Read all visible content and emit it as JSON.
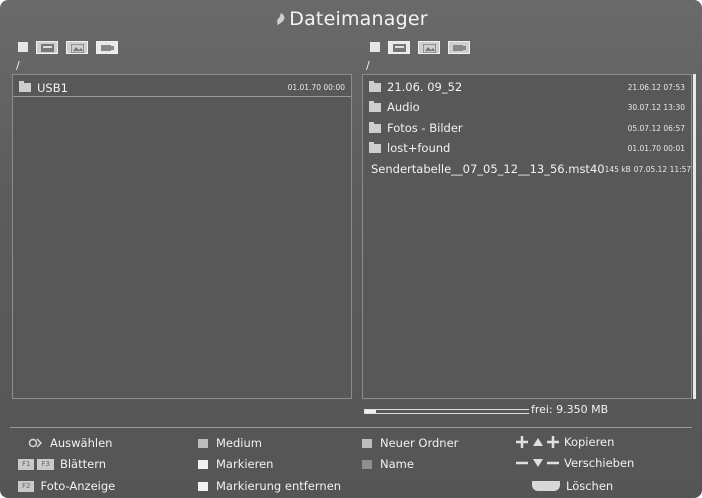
{
  "title": "Dateimanager",
  "left_pane": {
    "path": "/",
    "items": [
      {
        "name": "USB1",
        "date": "01.01.70 00:00",
        "icon": "folder-icon"
      }
    ]
  },
  "right_pane": {
    "path": "/",
    "items": [
      {
        "name": "21.06. 09_52",
        "date": "21.06.12 07:53",
        "icon": "folder-icon"
      },
      {
        "name": "Audio",
        "date": "30.07.12 13:30",
        "icon": "folder-icon"
      },
      {
        "name": "Fotos - Bilder",
        "date": "05.07.12 06:57",
        "icon": "folder-icon"
      },
      {
        "name": "lost+found",
        "date": "01.01.70 00:01",
        "icon": "folder-icon"
      },
      {
        "name": "Sendertabelle__07_05_12__13_56.mst40",
        "size": "145 kB",
        "date": "07.05.12 11:57",
        "icon": "file-icon"
      }
    ],
    "free_space": "frei: 9.350 MB",
    "used_fraction": 0.07
  },
  "legend": {
    "ok": "Auswählen",
    "f1": "F1",
    "f3": "F3",
    "blaettern": "Blättern",
    "f2": "F2",
    "foto": "Foto-Anzeige",
    "medium": "Medium",
    "markieren": "Markieren",
    "markierung_entfernen": "Markierung entfernen",
    "neuer_ordner": "Neuer Ordner",
    "name": "Name",
    "kopieren": "Kopieren",
    "verschieben": "Verschieben",
    "loeschen": "Löschen"
  }
}
